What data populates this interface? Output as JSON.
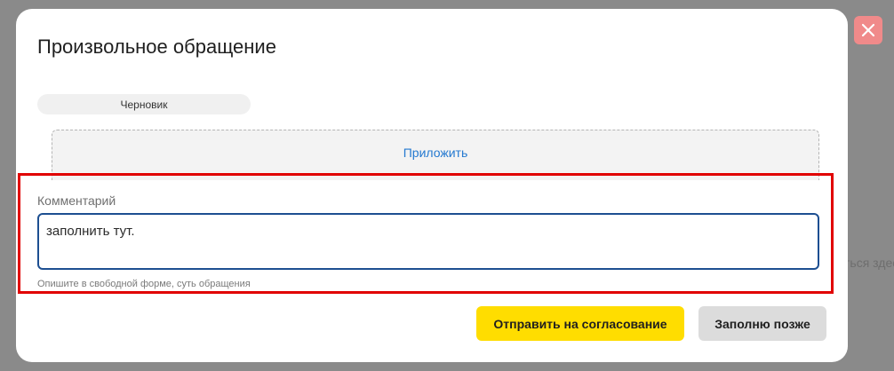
{
  "background": {
    "partial_text": "ться здес"
  },
  "close_button": {
    "icon": "close-icon",
    "color": "#f08a8a"
  },
  "modal": {
    "title": "Произвольное обращение",
    "status_badge": "Черновик",
    "attach_label": "Приложить",
    "comment": {
      "label": "Комментарий",
      "value": "заполнить тут.",
      "hint": "Опишите в свободной форме, суть обращения"
    },
    "buttons": {
      "submit": "Отправить на согласование",
      "later": "Заполню позже"
    }
  },
  "colors": {
    "primary_button": "#ffdd00",
    "secondary_button": "#dcdcdc",
    "link": "#2479d0",
    "input_border": "#1d4f91",
    "highlight": "#e10000"
  }
}
